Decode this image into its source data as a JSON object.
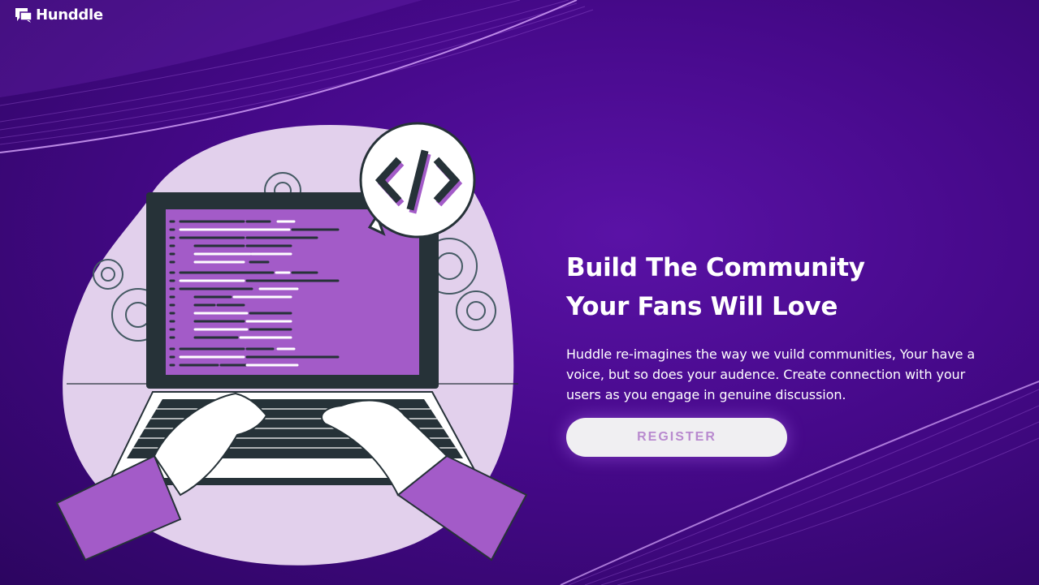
{
  "brand": {
    "name": "Hunddle",
    "icon": "chat-bubbles-icon"
  },
  "hero": {
    "headline_line1": "Build The Community",
    "headline_line2": "Your Fans Will Love",
    "description": "Huddle re-imagines the way we vuild communities, Your have a voice, but so does your audence. Create connection with your users as you engage in genuine discussion.",
    "cta_label": "REGISTER"
  },
  "illustration": {
    "subject": "person typing on laptop with code",
    "badge_icon": "code-brackets-icon"
  },
  "colors": {
    "background": "#46098a",
    "accent_purple": "#a35bc8",
    "blob": "#e2d0ec",
    "button_bg": "#f0eff2",
    "button_text": "#b98acf",
    "laptop_dark": "#263238"
  }
}
